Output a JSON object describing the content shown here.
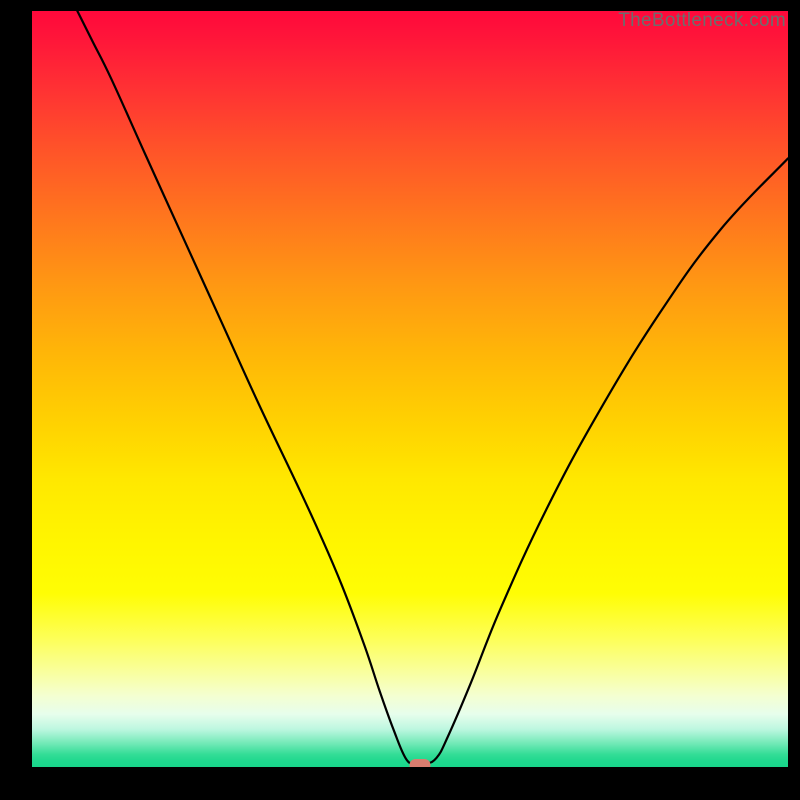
{
  "watermark": "TheBottleneck.com",
  "colors": {
    "frame_bg": "#000000",
    "curve_stroke": "#000000",
    "marker_fill": "#d97d6f",
    "watermark_text": "#6d6d6d",
    "gradient_top": "#ff083b",
    "gradient_bottom": "#18d68a"
  },
  "chart_data": {
    "type": "line",
    "title": "",
    "xlabel": "",
    "ylabel": "",
    "xlim": [
      0,
      100
    ],
    "ylim": [
      0,
      100
    ],
    "grid": false,
    "series": [
      {
        "name": "bottleneck-curve",
        "x": [
          6,
          8,
          10.5,
          15,
          20,
          25,
          30,
          35,
          38,
          41,
          44,
          46,
          47.8,
          49.4,
          50.6,
          52,
          53.5,
          55,
          58,
          62,
          68,
          75,
          83,
          91,
          100
        ],
        "y": [
          100,
          96,
          91,
          81,
          70,
          59,
          48,
          37.5,
          31,
          24,
          16,
          10,
          5,
          1.2,
          0.4,
          0.4,
          1.2,
          4,
          11,
          21,
          34,
          47,
          60,
          71,
          80.5
        ]
      }
    ],
    "marker": {
      "x": 51.3,
      "y": 0.3
    },
    "notes": "Axes are unlabeled in the image; x/y expressed as 0-100 percent of plot area. Minimum (bottleneck point) indicated by a small rounded marker near y≈0."
  }
}
